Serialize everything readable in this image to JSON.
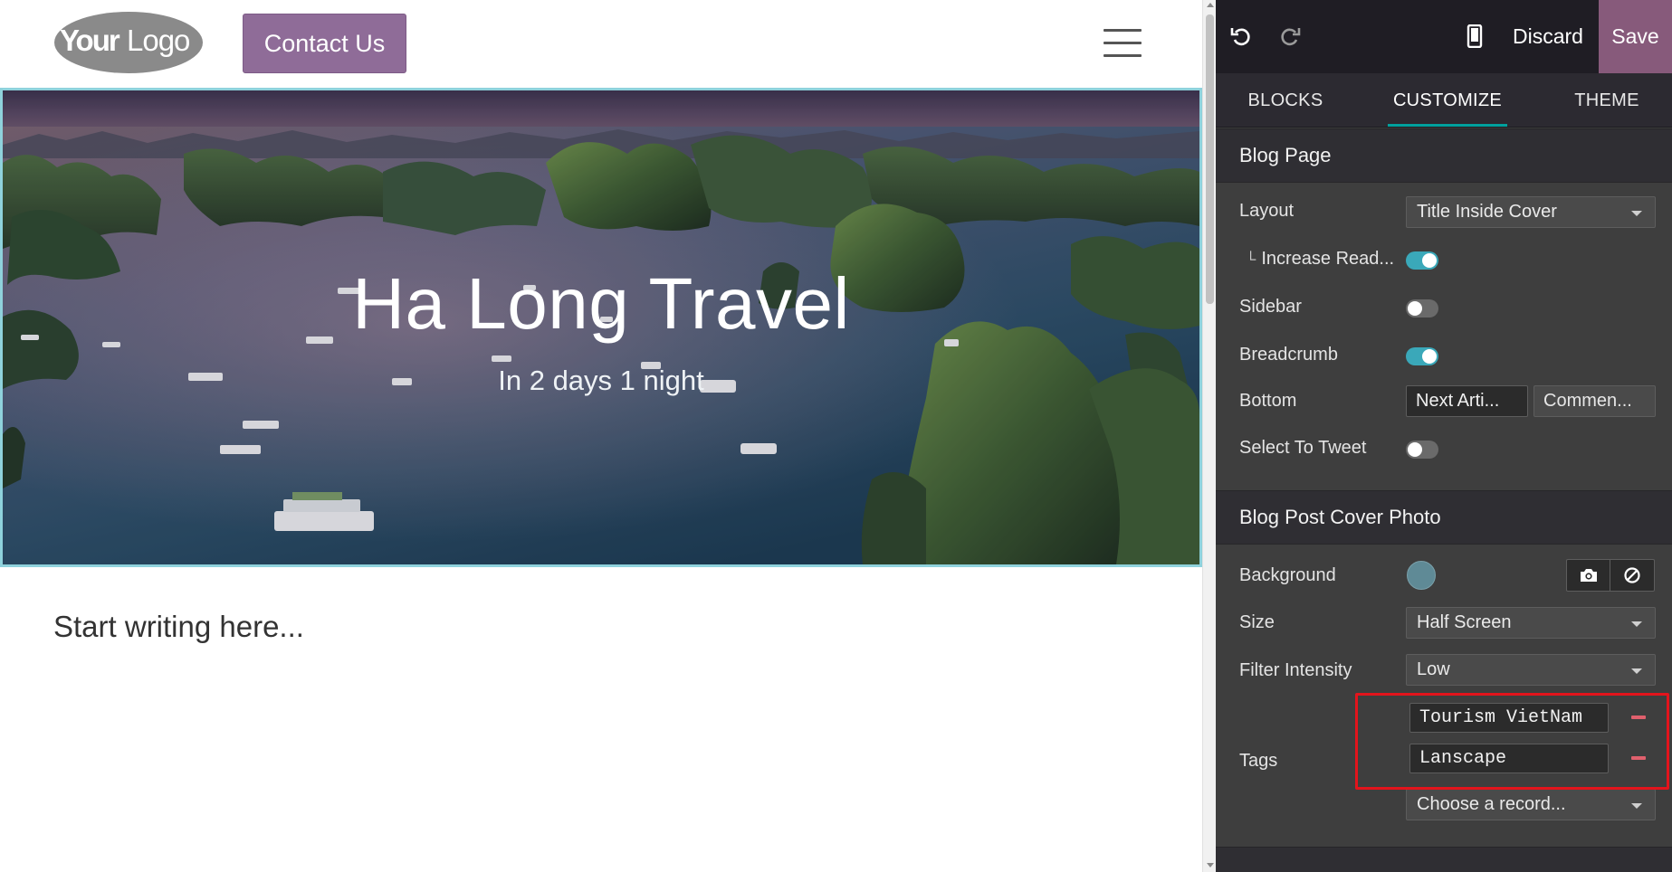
{
  "site": {
    "logo_bold": "Your",
    "logo_light": "Logo",
    "contact_label": "Contact Us",
    "cover": {
      "title": "Ha Long Travel",
      "subtitle": "In 2 days 1 night"
    },
    "body_placeholder": "Start writing here..."
  },
  "toolbar": {
    "undo_icon": "undo-icon",
    "redo_icon": "redo-icon",
    "mobile_icon": "mobile-phone-icon",
    "discard_label": "Discard",
    "save_label": "Save",
    "save_color": "#875a7b"
  },
  "tabs": [
    {
      "label": "BLOCKS",
      "active": false
    },
    {
      "label": "CUSTOMIZE",
      "active": true
    },
    {
      "label": "THEME",
      "active": false
    }
  ],
  "blog_page": {
    "heading": "Blog Page",
    "layout_label": "Layout",
    "layout_value": "Title Inside Cover",
    "increase_read_label": "Increase Read...",
    "increase_read_prefix": "└",
    "increase_read_on": true,
    "sidebar_label": "Sidebar",
    "sidebar_on": false,
    "breadcrumb_label": "Breadcrumb",
    "breadcrumb_on": true,
    "bottom_label": "Bottom",
    "bottom_next": "Next Arti...",
    "bottom_comments": "Commen...",
    "select_to_tweet_label": "Select To Tweet",
    "select_to_tweet_on": false
  },
  "cover_photo": {
    "heading": "Blog Post Cover Photo",
    "background_label": "Background",
    "background_color": "#5f8a96",
    "camera_icon": "camera-icon",
    "clear_icon": "clear-ban-icon",
    "size_label": "Size",
    "size_value": "Half Screen",
    "filter_label": "Filter Intensity",
    "filter_value": "Low",
    "tags_label": "Tags",
    "tags": [
      "Tourism VietNam",
      "Lanscape"
    ],
    "tags_placeholder": "Choose a record..."
  },
  "colors": {
    "accent_teal": "#00a09d",
    "toggle_on": "#3aa8b9",
    "contact_button": "#8f6c98",
    "highlight_red": "#e3141c",
    "remove_red": "#e0606d"
  }
}
